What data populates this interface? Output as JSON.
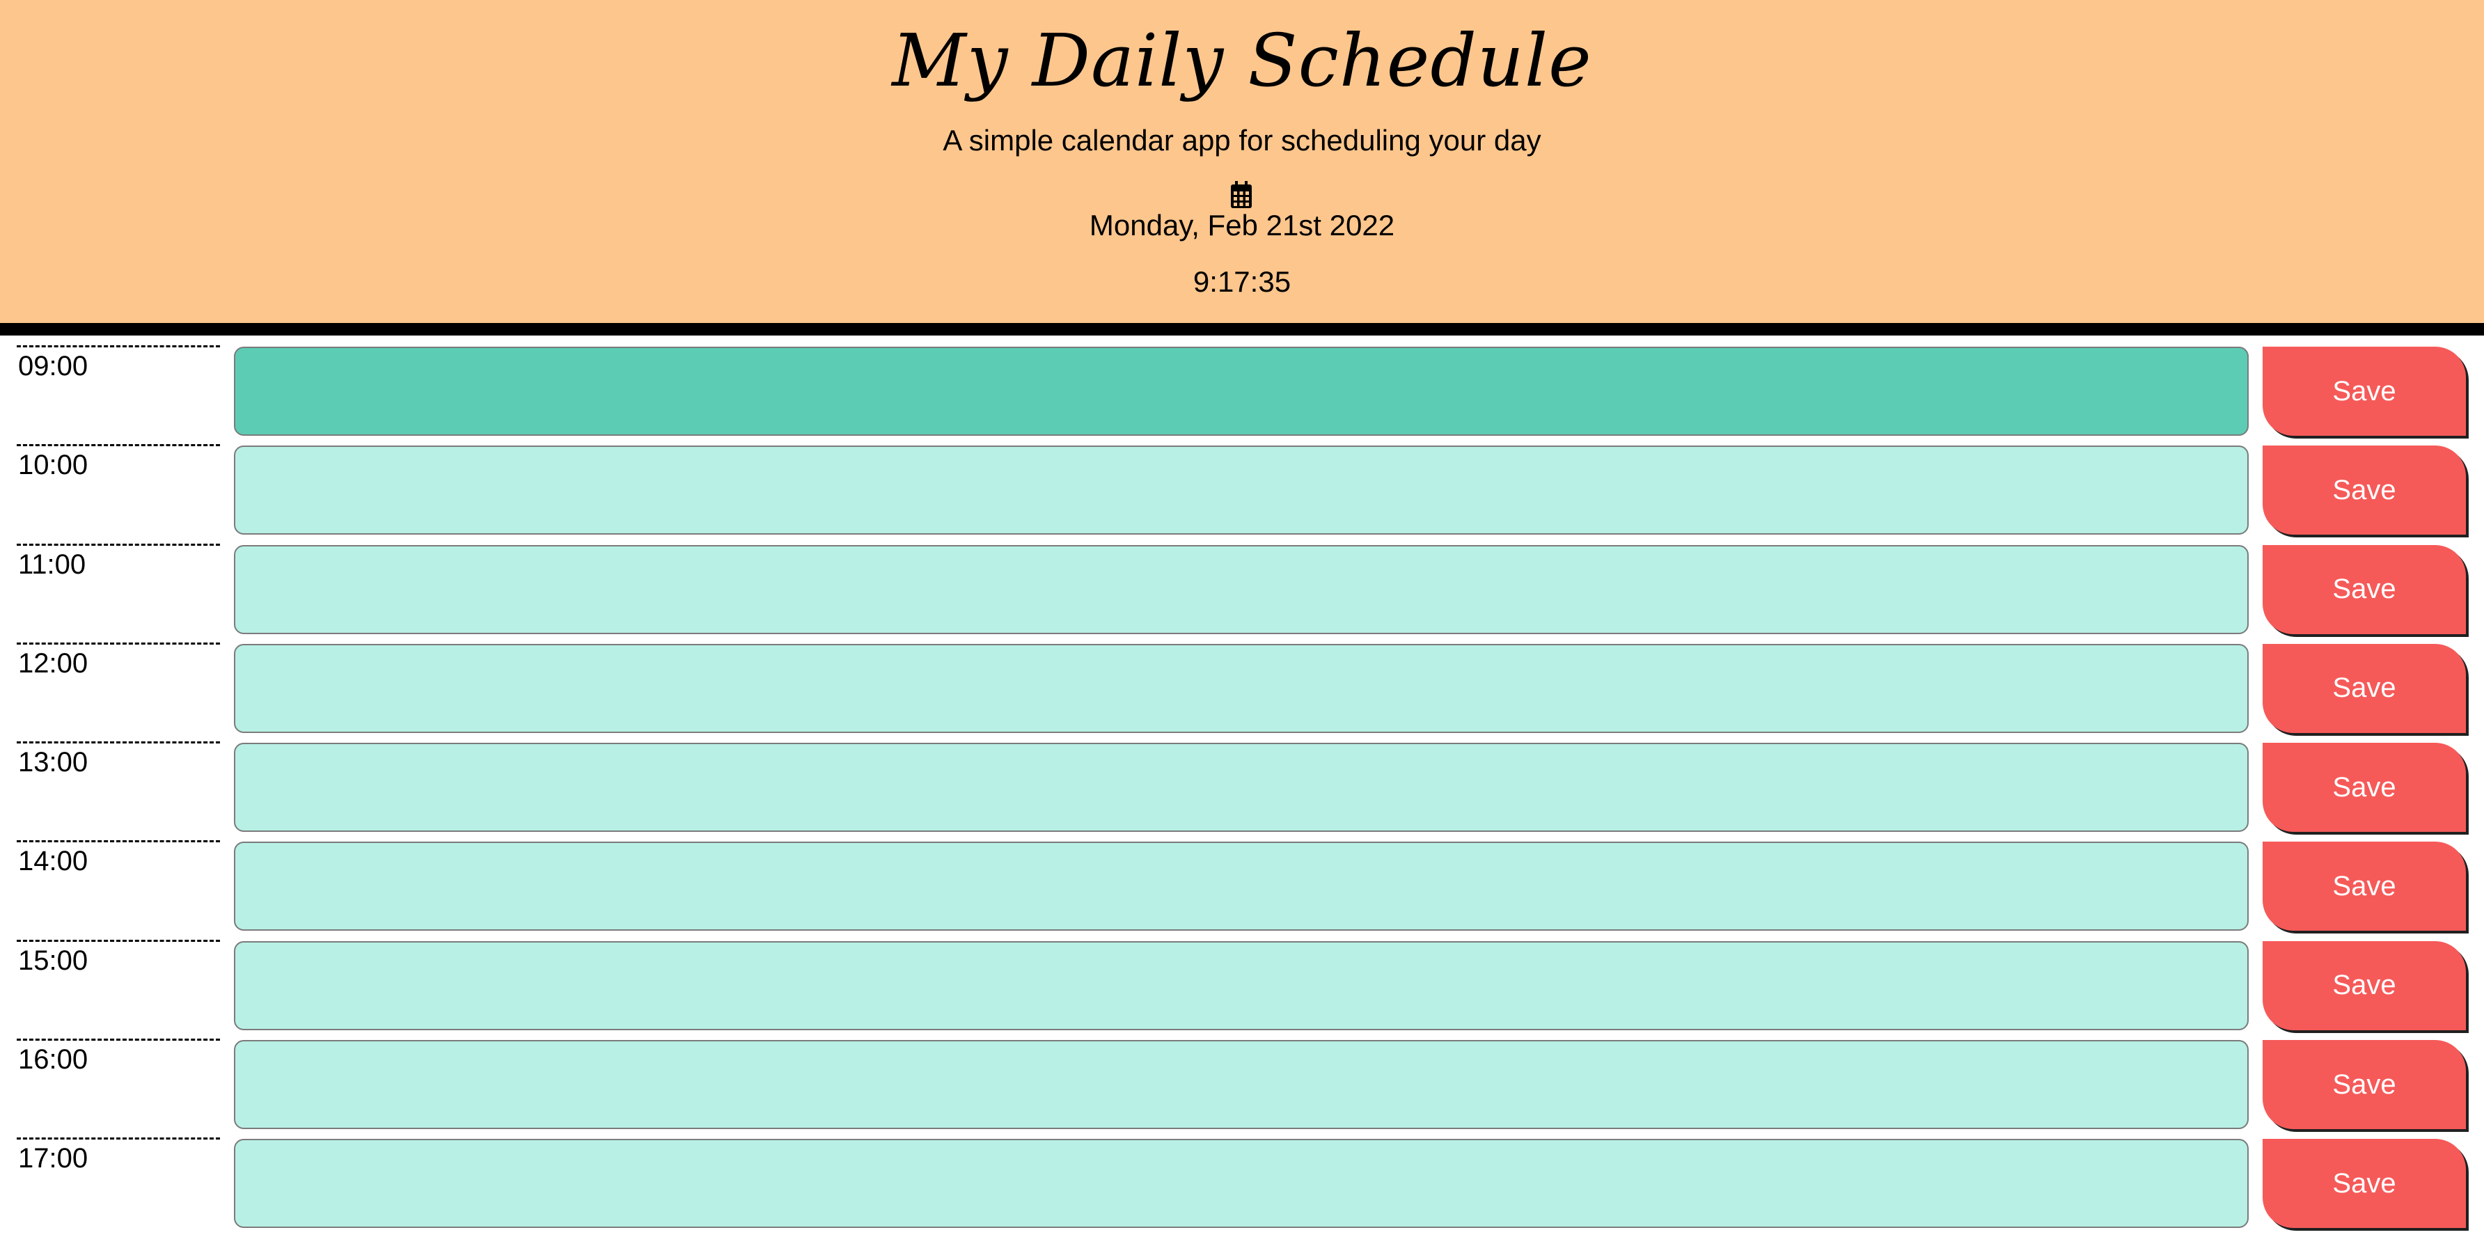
{
  "header": {
    "title": "My Daily Schedule",
    "subtitle": "A simple calendar app for scheduling your day",
    "date_icon": "calendar-icon",
    "current_day": "Monday, Feb 21st 2022",
    "current_time": "9:17:35"
  },
  "colors": {
    "header_bg": "#fcc68d",
    "present": "#5ccdb4",
    "future": "#b8f0e5",
    "save_button": "#f55a59"
  },
  "schedule": [
    {
      "hour": "09:00",
      "text": "",
      "state": "present",
      "save_label": "Save"
    },
    {
      "hour": "10:00",
      "text": "",
      "state": "future",
      "save_label": "Save"
    },
    {
      "hour": "11:00",
      "text": "",
      "state": "future",
      "save_label": "Save"
    },
    {
      "hour": "12:00",
      "text": "",
      "state": "future",
      "save_label": "Save"
    },
    {
      "hour": "13:00",
      "text": "",
      "state": "future",
      "save_label": "Save"
    },
    {
      "hour": "14:00",
      "text": "",
      "state": "future",
      "save_label": "Save"
    },
    {
      "hour": "15:00",
      "text": "",
      "state": "future",
      "save_label": "Save"
    },
    {
      "hour": "16:00",
      "text": "",
      "state": "future",
      "save_label": "Save"
    },
    {
      "hour": "17:00",
      "text": "",
      "state": "future",
      "save_label": "Save"
    }
  ]
}
